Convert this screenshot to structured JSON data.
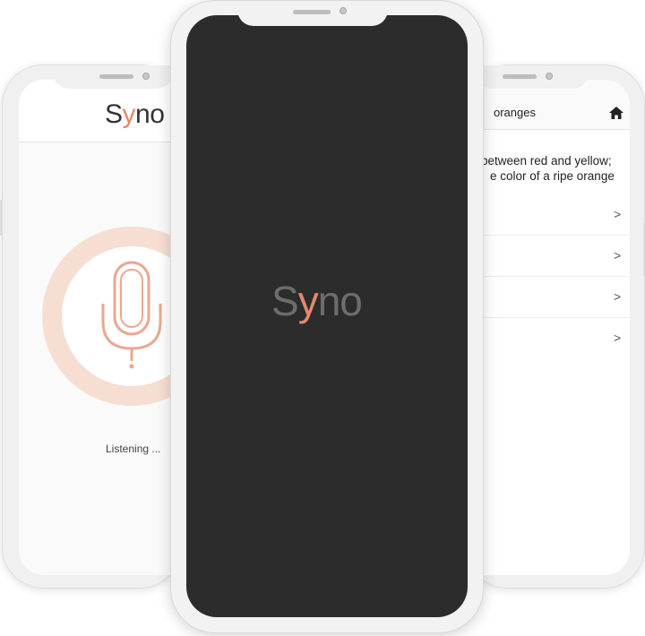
{
  "left_screen": {
    "logo": {
      "prefix": "S",
      "accent": "y",
      "suffix": "no"
    },
    "status_text": "Listening ..."
  },
  "center_screen": {
    "logo": {
      "prefix": "S",
      "accent": "y",
      "suffix": "no"
    }
  },
  "right_screen": {
    "title": "oranges",
    "definition_line1": "between red and yellow;",
    "definition_line2": "e color of a ripe orange",
    "rows": [
      ">",
      ">",
      ">",
      ">"
    ]
  },
  "colors": {
    "accent": "#e8876b",
    "ring": "#f6ded3",
    "splash_background": "#2c2c2c"
  },
  "icons": [
    "microphone-icon",
    "home-icon",
    "chevron-right-icon"
  ]
}
